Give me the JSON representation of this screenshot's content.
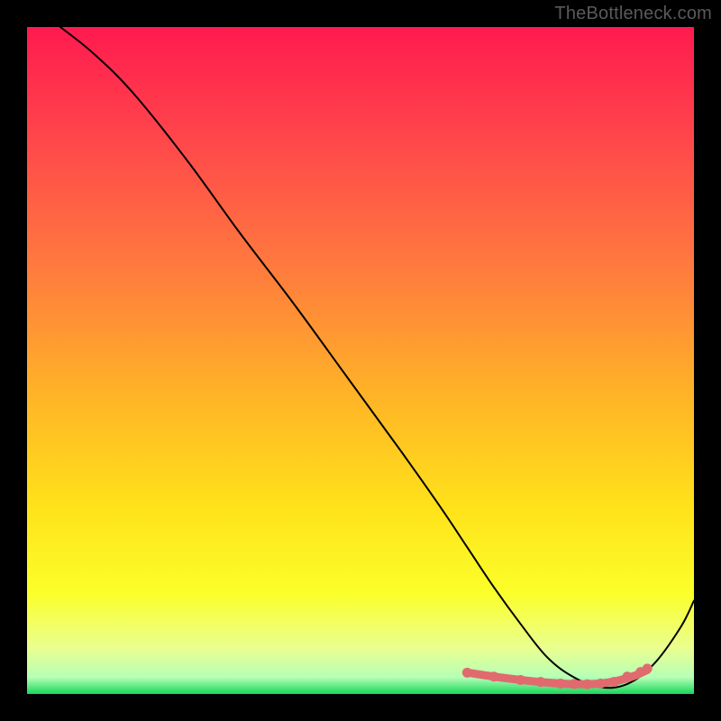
{
  "attribution": "TheBottleneck.com",
  "gradient": {
    "stops": [
      {
        "offset": 0.0,
        "color": "#ff1a4f"
      },
      {
        "offset": 0.18,
        "color": "#ff4a4a"
      },
      {
        "offset": 0.36,
        "color": "#ff7a3e"
      },
      {
        "offset": 0.55,
        "color": "#ffb327"
      },
      {
        "offset": 0.72,
        "color": "#ffe21a"
      },
      {
        "offset": 0.85,
        "color": "#fbff2a"
      },
      {
        "offset": 0.93,
        "color": "#eaff8e"
      },
      {
        "offset": 0.975,
        "color": "#b7ffb7"
      },
      {
        "offset": 1.0,
        "color": "#18d65a"
      }
    ]
  },
  "chart_data": {
    "type": "line",
    "title": "",
    "xlabel": "",
    "ylabel": "",
    "xlim": [
      0,
      100
    ],
    "ylim": [
      0,
      100
    ],
    "series": [
      {
        "name": "main-curve",
        "color": "#000000",
        "stroke_width": 2,
        "x": [
          5,
          10,
          16,
          24,
          32,
          40,
          48,
          56,
          62,
          66,
          70,
          74,
          78,
          82,
          86,
          90,
          94,
          98,
          100
        ],
        "y": [
          100,
          96,
          90,
          80,
          69,
          58.5,
          47.5,
          36.5,
          28,
          22,
          16,
          10.5,
          5.5,
          2.5,
          1,
          1.5,
          4.5,
          10,
          14
        ]
      },
      {
        "name": "highlight-band",
        "color": "#e16a6f",
        "stroke_width": 9,
        "x": [
          66,
          70,
          74,
          78,
          81,
          83,
          85,
          87,
          89,
          91,
          93
        ],
        "y": [
          3.2,
          2.6,
          2.1,
          1.7,
          1.5,
          1.45,
          1.5,
          1.7,
          2.1,
          2.7,
          3.6
        ]
      }
    ],
    "highlight_points": {
      "color": "#e16a6f",
      "radius": 5.5,
      "x": [
        66,
        70,
        74,
        77,
        80,
        82,
        84,
        86,
        88,
        90,
        92,
        93
      ],
      "y": [
        3.2,
        2.6,
        2.1,
        1.8,
        1.55,
        1.5,
        1.45,
        1.55,
        1.8,
        2.6,
        3.3,
        3.8
      ]
    }
  }
}
